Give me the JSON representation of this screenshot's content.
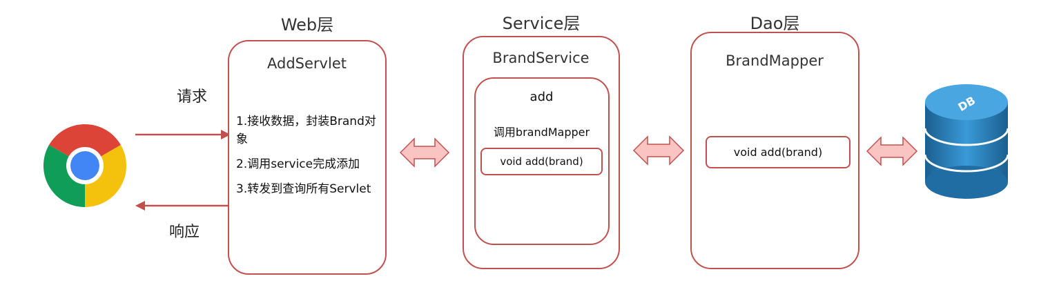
{
  "layers": {
    "web": "Web层",
    "service": "Service层",
    "dao": "Dao层"
  },
  "web_panel": {
    "title": "AddServlet",
    "steps": [
      "1.接收数据，封装Brand对象",
      "2.调用service完成添加",
      "3.转发到查询所有Servlet"
    ]
  },
  "service_panel": {
    "title": "BrandService",
    "method_title": "add",
    "call_text": "调用brandMapper",
    "call_box": "void add(brand)"
  },
  "dao_panel": {
    "title": "BrandMapper",
    "method_box": "void add(brand)"
  },
  "labels": {
    "request": "请求",
    "response": "响应"
  },
  "db_label": "DB",
  "colors": {
    "panel_border": "#c0504d",
    "arrow_fill": "#f9c4c2",
    "db_blue": "#2e86c1"
  },
  "icons": {
    "browser": "chrome-icon",
    "database": "database-icon"
  }
}
